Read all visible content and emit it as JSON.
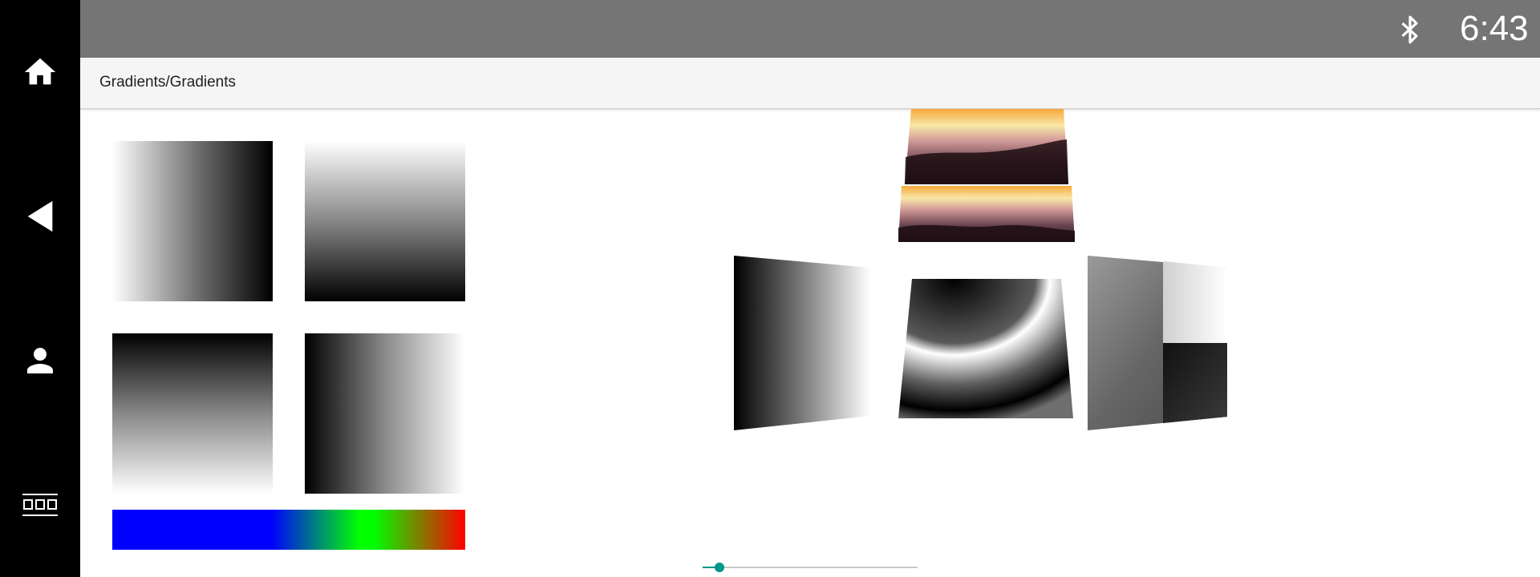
{
  "rail": {
    "items": [
      {
        "icon": "home-icon"
      },
      {
        "icon": "back-icon"
      },
      {
        "icon": "person-icon"
      },
      {
        "icon": "apps-grid-icon"
      }
    ]
  },
  "status_bar": {
    "bluetooth_icon": "bluetooth-icon",
    "time": "6:43 PM",
    "color": "#757575"
  },
  "title_bar": {
    "title": "Gradients/Gradients"
  },
  "gradients": [
    {
      "name": "linear-horizontal-white-to-black",
      "colors": [
        "#ffffff",
        "#000000"
      ]
    },
    {
      "name": "linear-vertical-white-to-black",
      "colors": [
        "#ffffff",
        "#000000"
      ]
    },
    {
      "name": "linear-vertical-black-to-white",
      "colors": [
        "#000000",
        "#ffffff"
      ]
    },
    {
      "name": "linear-horizontal-black-to-white",
      "colors": [
        "#000000",
        "#ffffff"
      ]
    },
    {
      "name": "linear-blue-green-red",
      "colors": [
        "#0000ff",
        "#00ff00",
        "#ff0000"
      ]
    }
  ],
  "seek_bar": {
    "accent": "#009688",
    "progress": 0.08
  }
}
